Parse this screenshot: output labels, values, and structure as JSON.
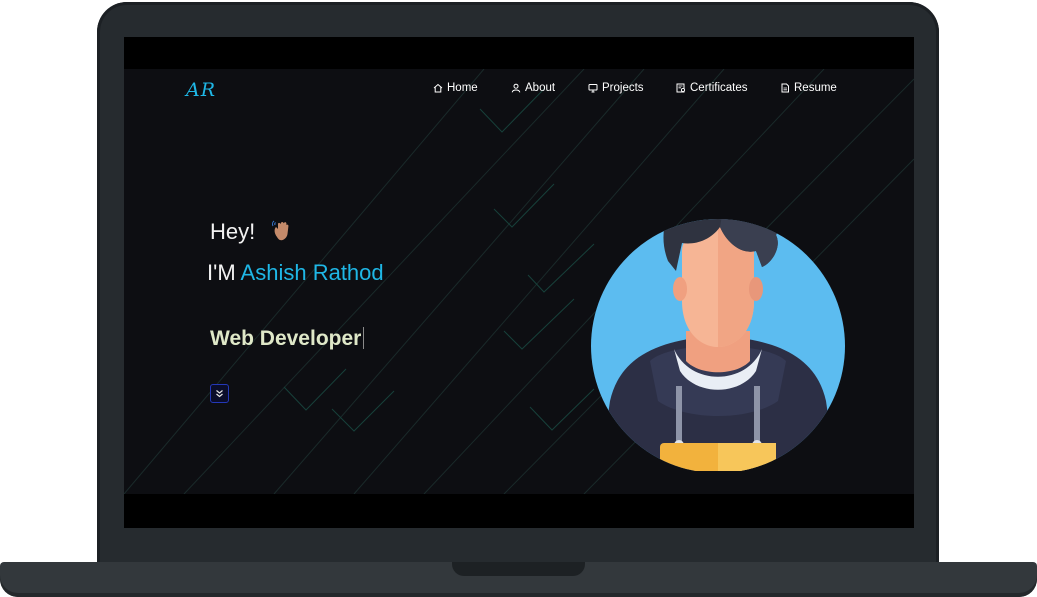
{
  "site": {
    "logo": "AR",
    "nav": [
      {
        "label": "Home",
        "icon": "home-icon"
      },
      {
        "label": "About",
        "icon": "user-icon"
      },
      {
        "label": "Projects",
        "icon": "monitor-icon"
      },
      {
        "label": "Certificates",
        "icon": "certificate-icon"
      },
      {
        "label": "Resume",
        "icon": "document-icon"
      }
    ],
    "hero": {
      "greeting": "Hey!",
      "intro_prefix": "I'M ",
      "name": "Ashish Rathod",
      "role": "Web Developer",
      "wave_icon": "waving-hand-icon",
      "scroll_icon": "double-chevron-down-icon"
    }
  },
  "colors": {
    "accent": "#1fb7e6",
    "background": "#0d0e12",
    "role_text": "#dfe8c8",
    "avatar_circle": "#5cbcf0"
  }
}
